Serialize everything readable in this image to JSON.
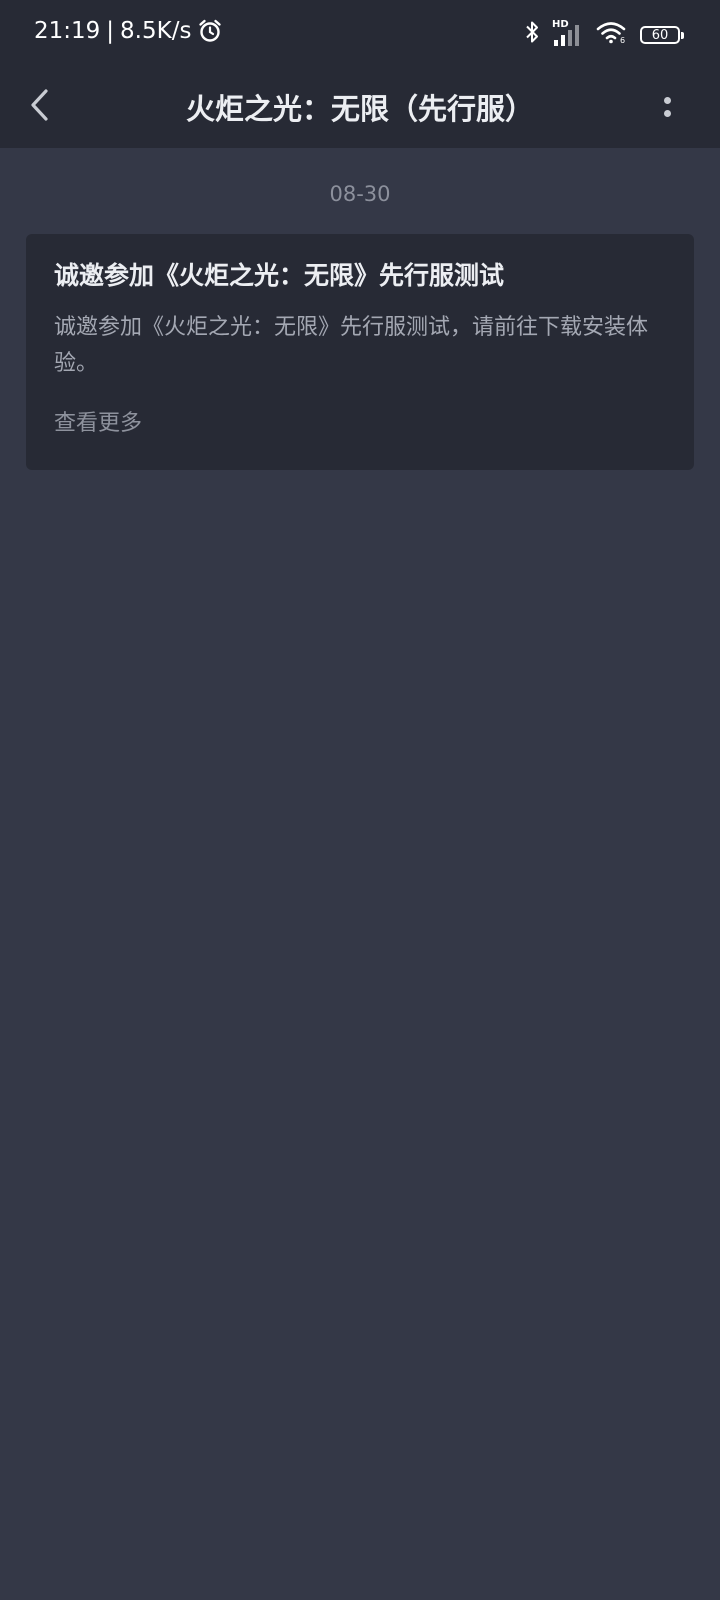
{
  "status_bar": {
    "time": "21:19",
    "separator": "|",
    "speed": "8.5K/s",
    "network_badge": "HD",
    "battery": "60"
  },
  "header": {
    "title": "火炬之光：无限（先行服）"
  },
  "messages": [
    {
      "date": "08-30",
      "title": "诚邀参加《火炬之光：无限》先行服测试",
      "body": "诚邀参加《火炬之光：无限》先行服测试，请前往下载安装体验。",
      "more_label": "查看更多"
    }
  ]
}
